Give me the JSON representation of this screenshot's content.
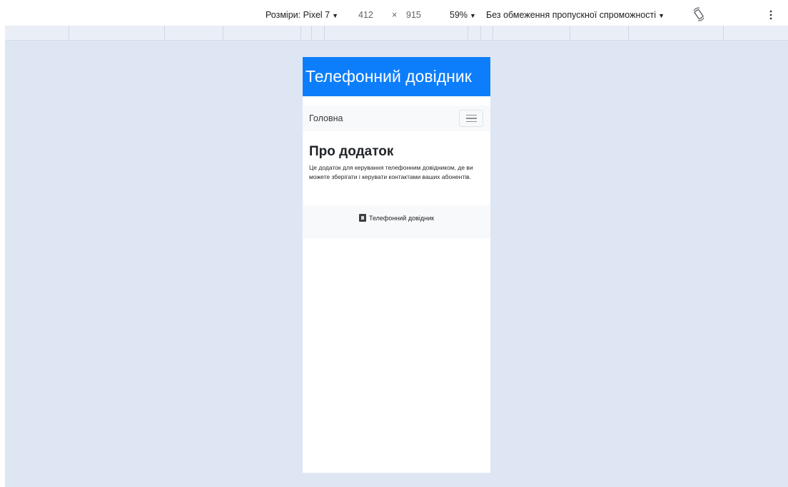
{
  "devtools": {
    "dimensions_label": "Розміри: Pixel 7",
    "width_value": "412",
    "times_sign": "×",
    "height_value": "915",
    "zoom_value": "59%",
    "throttling_label": "Без обмеження пропускної спроможності",
    "rotate_icon": "rotate-icon",
    "more_icon": "vertical-dots-icon"
  },
  "app": {
    "header_title": "Телефонний довідник",
    "navbar": {
      "home_link": "Головна",
      "toggle_icon": "hamburger-icon"
    },
    "about": {
      "title": "Про додаток",
      "text": "Це додаток для керування телефонним довідником, де ви можете зберігати і керувати контактами ваших абонентів."
    },
    "footer": {
      "icon": "phone-book-icon",
      "label": "Телефонний довідник"
    },
    "colors": {
      "header_bg": "#0d7efb",
      "page_bg": "#dfe6f3"
    }
  }
}
